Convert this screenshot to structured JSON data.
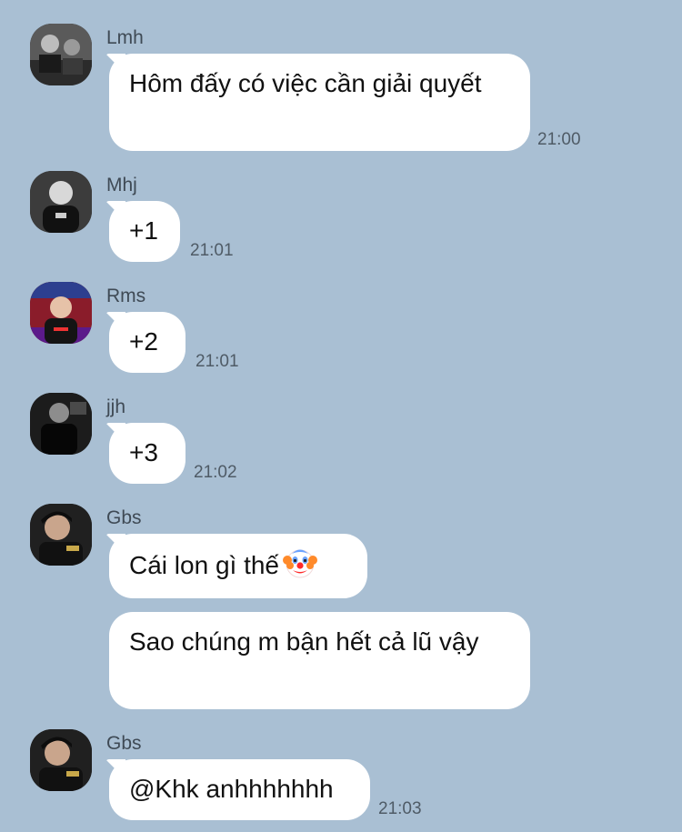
{
  "messages": [
    {
      "sender": "Lmh",
      "text": "Hôm đấy có việc cần giải quyết",
      "time": "21:00"
    },
    {
      "sender": "Mhj",
      "text": "+1",
      "time": "21:01"
    },
    {
      "sender": "Rms",
      "text": "+2",
      "time": "21:01"
    },
    {
      "sender": "jjh",
      "text": "+3",
      "time": "21:02"
    },
    {
      "sender": "Gbs",
      "text": "Cái lon gì thế",
      "emoji": "clown-face-icon"
    },
    {
      "text": "Sao chúng m bận hết cả lũ vậy"
    },
    {
      "sender": "Gbs",
      "text": "@Khk anhhhhhhh",
      "time": "21:03"
    }
  ],
  "colors": {
    "background": "#a9bfd3",
    "bubble": "#ffffff",
    "sender_text": "#3f4a55",
    "time_text": "#4f5b66"
  }
}
